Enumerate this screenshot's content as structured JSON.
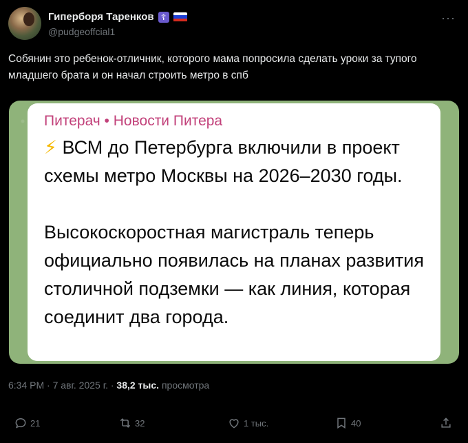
{
  "author": {
    "name": "Гиперборя Таренков",
    "handle": "@pudgeoffcial1"
  },
  "tweet": {
    "text": "Собянин это ребенок-отличник, которого мама попросила сделать уроки за тупого младшего брата и он начал строить метро в спб"
  },
  "media": {
    "channel": "Питерач • Новости Питера",
    "paragraph1": "ВСМ до Петербурга включили в проект схемы метро Москвы на 2026–2030 годы.",
    "paragraph2": "Высокоскоростная магистраль теперь официально появилась на планах развития столичной подземки — как линия, которая соединит два города.",
    "bolt": "⚡"
  },
  "meta": {
    "timestamp": "6:34 PM · 7 авг. 2025 г. · ",
    "views_count": "38,2 тыс.",
    "views_label": " просмотра"
  },
  "actions": {
    "replies": "21",
    "reposts": "32",
    "likes": "1 тыс.",
    "bookmarks": "40"
  },
  "colors": {
    "background": "#000000",
    "channel": "#c2417a",
    "media_bg": "#8fb37a"
  }
}
